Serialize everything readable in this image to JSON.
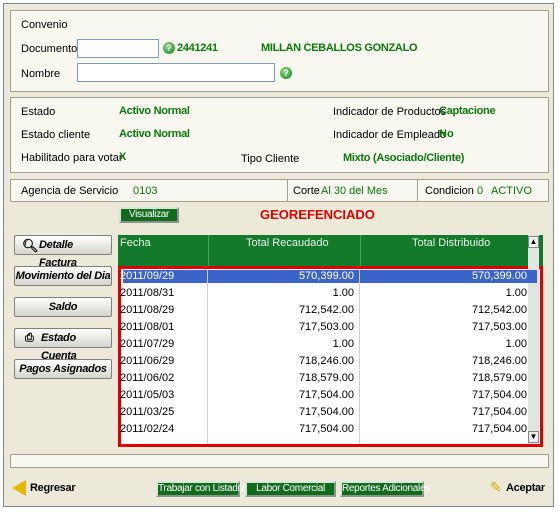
{
  "convenio": {
    "title": "Convenio"
  },
  "documento": {
    "label": "Documento",
    "number": "2441241",
    "name": "MILLAN CEBALLOS GONZALO"
  },
  "nombre": {
    "label": "Nombre"
  },
  "status": {
    "estado_label": "Estado",
    "estado_value": "Activo Normal",
    "estado_cliente_label": "Estado cliente",
    "estado_cliente_value": "Activo Normal",
    "habilitado_label": "Habilitado para votar",
    "habilitado_value": "X",
    "ind_productos_label": "Indicador de Productos",
    "ind_productos_value": "Captacione",
    "ind_empleado_label": "Indicador de Empleado",
    "ind_empleado_value": "No",
    "tipo_cliente_label": "Tipo Cliente",
    "tipo_cliente_value": "Mixto (Asociado/Cliente)"
  },
  "agencia": {
    "label": "Agencia de Servicio",
    "value": "0103",
    "corte_label": "Corte",
    "corte_value": "Al 30 del Mes",
    "condicion_label": "Condicion",
    "condicion_code": "0",
    "condicion_value": "ACTIVO"
  },
  "visualizar_label": "Visualizar",
  "georef_title": "GEOREFENCIADO",
  "sidebar": [
    {
      "label": "Detalle Factura"
    },
    {
      "label": "Movimiento del Dia"
    },
    {
      "label": "Saldo"
    },
    {
      "label": "Estado Cuenta"
    },
    {
      "label": "Pagos Asignados"
    }
  ],
  "table": {
    "headers": [
      "Fecha",
      "Total Recaudado",
      "Total Distribuido"
    ],
    "rows": [
      {
        "fecha": "2011/09/29",
        "recaudado": "570,399.00",
        "distribuido": "570,399.00"
      },
      {
        "fecha": "2011/08/31",
        "recaudado": "1.00",
        "distribuido": "1.00"
      },
      {
        "fecha": "2011/08/29",
        "recaudado": "712,542.00",
        "distribuido": "712,542.00"
      },
      {
        "fecha": "2011/08/01",
        "recaudado": "717,503.00",
        "distribuido": "717,503.00"
      },
      {
        "fecha": "2011/07/29",
        "recaudado": "1.00",
        "distribuido": "1.00"
      },
      {
        "fecha": "2011/06/29",
        "recaudado": "718,246.00",
        "distribuido": "718,246.00"
      },
      {
        "fecha": "2011/06/02",
        "recaudado": "718,579.00",
        "distribuido": "718,579.00"
      },
      {
        "fecha": "2011/05/03",
        "recaudado": "717,504.00",
        "distribuido": "717,504.00"
      },
      {
        "fecha": "2011/03/25",
        "recaudado": "717,504.00",
        "distribuido": "717,504.00"
      },
      {
        "fecha": "2011/02/24",
        "recaudado": "717,504.00",
        "distribuido": "717,504.00"
      }
    ]
  },
  "footer": {
    "regresar": "Regresar",
    "trabajar": "Trabajar con Listados",
    "labor": "Labor Comercial",
    "reportes": "Reportes Adicionales",
    "aceptar": "Aceptar"
  },
  "colors": {
    "accent_green": "#127a2a",
    "selected_row": "#3a64c8",
    "highlight_red": "#e00000"
  }
}
